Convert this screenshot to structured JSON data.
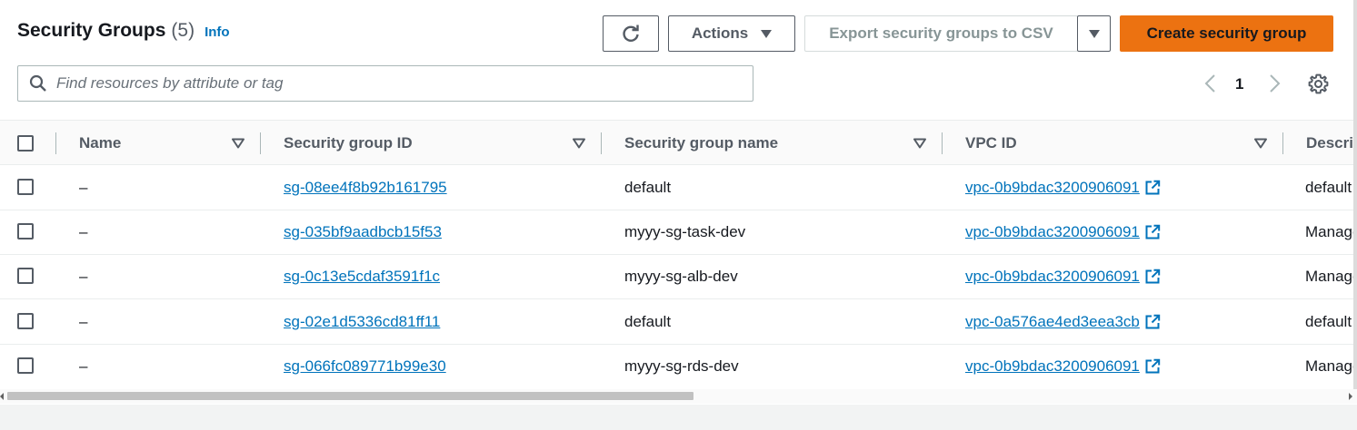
{
  "header": {
    "title": "Security Groups",
    "count": "(5)",
    "info": "Info"
  },
  "toolbar": {
    "actions_label": "Actions",
    "export_label": "Export security groups to CSV",
    "create_label": "Create security group"
  },
  "search": {
    "placeholder": "Find resources by attribute or tag"
  },
  "pagination": {
    "current_page": "1"
  },
  "table": {
    "columns": [
      "Name",
      "Security group ID",
      "Security group name",
      "VPC ID",
      "Descrip"
    ],
    "rows": [
      {
        "name": "–",
        "sg_id": "sg-08ee4f8b92b161795",
        "sg_name": "default",
        "vpc_id": "vpc-0b9bdac3200906091",
        "description": "default"
      },
      {
        "name": "–",
        "sg_id": "sg-035bf9aadbcb15f53",
        "sg_name": "myyy-sg-task-dev",
        "vpc_id": "vpc-0b9bdac3200906091",
        "description": "Manage"
      },
      {
        "name": "–",
        "sg_id": "sg-0c13e5cdaf3591f1c",
        "sg_name": "myyy-sg-alb-dev",
        "vpc_id": "vpc-0b9bdac3200906091",
        "description": "Manage"
      },
      {
        "name": "–",
        "sg_id": "sg-02e1d5336cd81ff11",
        "sg_name": "default",
        "vpc_id": "vpc-0a576ae4ed3eea3cb",
        "description": "default"
      },
      {
        "name": "–",
        "sg_id": "sg-066fc089771b99e30",
        "sg_name": "myyy-sg-rds-dev",
        "vpc_id": "vpc-0b9bdac3200906091",
        "description": "Manage"
      }
    ]
  },
  "icons": {
    "refresh": "refresh-icon",
    "search": "search-icon",
    "settings": "gear-icon",
    "external": "external-link-icon",
    "sort": "sort-down-icon"
  },
  "colors": {
    "primary": "#ec7211",
    "link": "#0073bb",
    "text": "#16191f",
    "muted": "#545b64"
  }
}
